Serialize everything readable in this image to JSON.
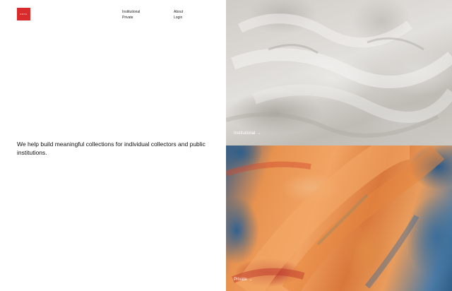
{
  "brand": {
    "logo_text": "KOYA",
    "logo_color": "#d92b2b"
  },
  "nav": {
    "links": [
      {
        "label": "Institutional"
      },
      {
        "label": "Private"
      },
      {
        "label": "About"
      },
      {
        "label": "Login"
      }
    ]
  },
  "hero": {
    "tagline": "We help build meaningful collections for individual collectors and public institutions."
  },
  "panels": [
    {
      "label": "Institutional",
      "arrow": "→",
      "image": "white-marble-relief-texture"
    },
    {
      "label": "Private",
      "arrow": "→",
      "image": "orange-blue-oil-paint-texture"
    }
  ]
}
